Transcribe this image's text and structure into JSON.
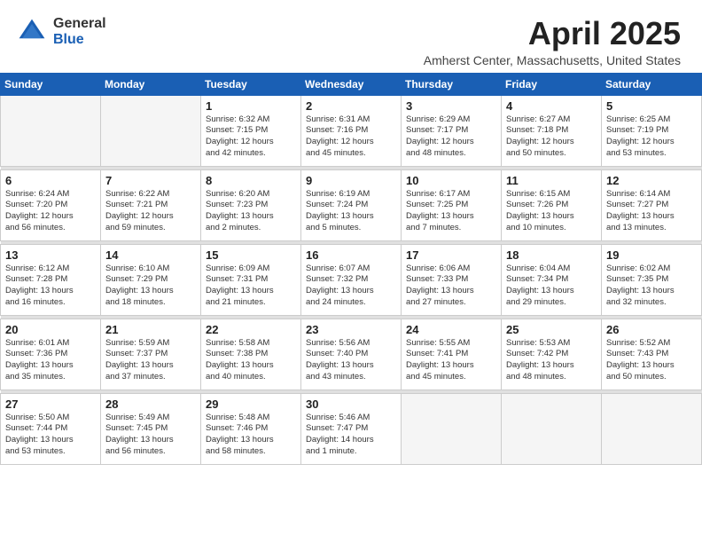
{
  "header": {
    "logo_general": "General",
    "logo_blue": "Blue",
    "month_title": "April 2025",
    "location": "Amherst Center, Massachusetts, United States"
  },
  "weekdays": [
    "Sunday",
    "Monday",
    "Tuesday",
    "Wednesday",
    "Thursday",
    "Friday",
    "Saturday"
  ],
  "weeks": [
    [
      {
        "day": "",
        "info": ""
      },
      {
        "day": "",
        "info": ""
      },
      {
        "day": "1",
        "info": "Sunrise: 6:32 AM\nSunset: 7:15 PM\nDaylight: 12 hours\nand 42 minutes."
      },
      {
        "day": "2",
        "info": "Sunrise: 6:31 AM\nSunset: 7:16 PM\nDaylight: 12 hours\nand 45 minutes."
      },
      {
        "day": "3",
        "info": "Sunrise: 6:29 AM\nSunset: 7:17 PM\nDaylight: 12 hours\nand 48 minutes."
      },
      {
        "day": "4",
        "info": "Sunrise: 6:27 AM\nSunset: 7:18 PM\nDaylight: 12 hours\nand 50 minutes."
      },
      {
        "day": "5",
        "info": "Sunrise: 6:25 AM\nSunset: 7:19 PM\nDaylight: 12 hours\nand 53 minutes."
      }
    ],
    [
      {
        "day": "6",
        "info": "Sunrise: 6:24 AM\nSunset: 7:20 PM\nDaylight: 12 hours\nand 56 minutes."
      },
      {
        "day": "7",
        "info": "Sunrise: 6:22 AM\nSunset: 7:21 PM\nDaylight: 12 hours\nand 59 minutes."
      },
      {
        "day": "8",
        "info": "Sunrise: 6:20 AM\nSunset: 7:23 PM\nDaylight: 13 hours\nand 2 minutes."
      },
      {
        "day": "9",
        "info": "Sunrise: 6:19 AM\nSunset: 7:24 PM\nDaylight: 13 hours\nand 5 minutes."
      },
      {
        "day": "10",
        "info": "Sunrise: 6:17 AM\nSunset: 7:25 PM\nDaylight: 13 hours\nand 7 minutes."
      },
      {
        "day": "11",
        "info": "Sunrise: 6:15 AM\nSunset: 7:26 PM\nDaylight: 13 hours\nand 10 minutes."
      },
      {
        "day": "12",
        "info": "Sunrise: 6:14 AM\nSunset: 7:27 PM\nDaylight: 13 hours\nand 13 minutes."
      }
    ],
    [
      {
        "day": "13",
        "info": "Sunrise: 6:12 AM\nSunset: 7:28 PM\nDaylight: 13 hours\nand 16 minutes."
      },
      {
        "day": "14",
        "info": "Sunrise: 6:10 AM\nSunset: 7:29 PM\nDaylight: 13 hours\nand 18 minutes."
      },
      {
        "day": "15",
        "info": "Sunrise: 6:09 AM\nSunset: 7:31 PM\nDaylight: 13 hours\nand 21 minutes."
      },
      {
        "day": "16",
        "info": "Sunrise: 6:07 AM\nSunset: 7:32 PM\nDaylight: 13 hours\nand 24 minutes."
      },
      {
        "day": "17",
        "info": "Sunrise: 6:06 AM\nSunset: 7:33 PM\nDaylight: 13 hours\nand 27 minutes."
      },
      {
        "day": "18",
        "info": "Sunrise: 6:04 AM\nSunset: 7:34 PM\nDaylight: 13 hours\nand 29 minutes."
      },
      {
        "day": "19",
        "info": "Sunrise: 6:02 AM\nSunset: 7:35 PM\nDaylight: 13 hours\nand 32 minutes."
      }
    ],
    [
      {
        "day": "20",
        "info": "Sunrise: 6:01 AM\nSunset: 7:36 PM\nDaylight: 13 hours\nand 35 minutes."
      },
      {
        "day": "21",
        "info": "Sunrise: 5:59 AM\nSunset: 7:37 PM\nDaylight: 13 hours\nand 37 minutes."
      },
      {
        "day": "22",
        "info": "Sunrise: 5:58 AM\nSunset: 7:38 PM\nDaylight: 13 hours\nand 40 minutes."
      },
      {
        "day": "23",
        "info": "Sunrise: 5:56 AM\nSunset: 7:40 PM\nDaylight: 13 hours\nand 43 minutes."
      },
      {
        "day": "24",
        "info": "Sunrise: 5:55 AM\nSunset: 7:41 PM\nDaylight: 13 hours\nand 45 minutes."
      },
      {
        "day": "25",
        "info": "Sunrise: 5:53 AM\nSunset: 7:42 PM\nDaylight: 13 hours\nand 48 minutes."
      },
      {
        "day": "26",
        "info": "Sunrise: 5:52 AM\nSunset: 7:43 PM\nDaylight: 13 hours\nand 50 minutes."
      }
    ],
    [
      {
        "day": "27",
        "info": "Sunrise: 5:50 AM\nSunset: 7:44 PM\nDaylight: 13 hours\nand 53 minutes."
      },
      {
        "day": "28",
        "info": "Sunrise: 5:49 AM\nSunset: 7:45 PM\nDaylight: 13 hours\nand 56 minutes."
      },
      {
        "day": "29",
        "info": "Sunrise: 5:48 AM\nSunset: 7:46 PM\nDaylight: 13 hours\nand 58 minutes."
      },
      {
        "day": "30",
        "info": "Sunrise: 5:46 AM\nSunset: 7:47 PM\nDaylight: 14 hours\nand 1 minute."
      },
      {
        "day": "",
        "info": ""
      },
      {
        "day": "",
        "info": ""
      },
      {
        "day": "",
        "info": ""
      }
    ]
  ]
}
